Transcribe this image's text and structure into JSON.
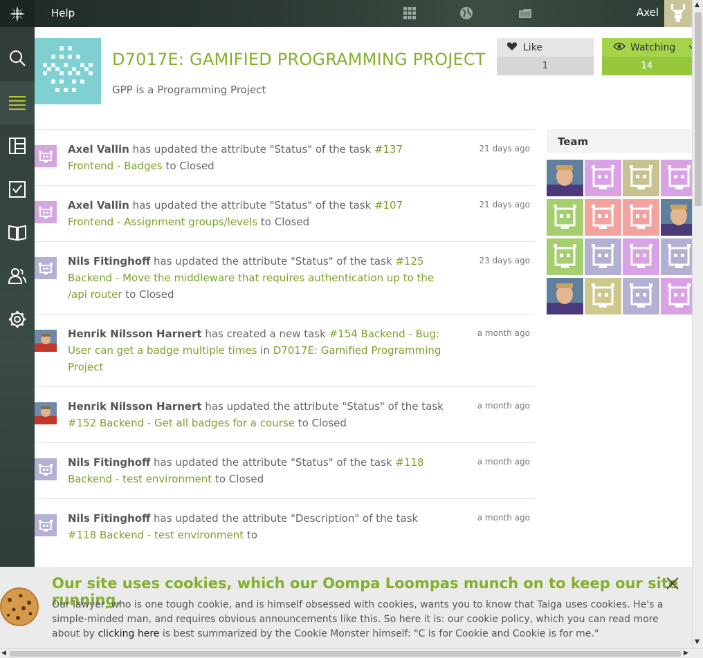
{
  "topbar": {
    "help_label": "Help",
    "username": "Axel",
    "icons": [
      "taiga-logo-icon",
      "projects-grid-icon",
      "discover-globe-icon",
      "folder-icon"
    ]
  },
  "sidebar": {
    "items": [
      {
        "name": "search",
        "icon": "search-icon"
      },
      {
        "name": "timeline",
        "icon": "timeline-lines-icon",
        "active": true
      },
      {
        "name": "kanban",
        "icon": "kanban-icon"
      },
      {
        "name": "backlog",
        "icon": "checklist-icon"
      },
      {
        "name": "wiki",
        "icon": "book-icon"
      },
      {
        "name": "team",
        "icon": "team-icon"
      },
      {
        "name": "settings",
        "icon": "gear-icon"
      }
    ]
  },
  "project": {
    "title": "D7017E: GAMIFIED PROGRAMMING PROJECT",
    "description": "GPP is a Programming Project",
    "like_label": "Like",
    "like_count": "1",
    "watch_label": "Watching",
    "watch_count": "14"
  },
  "timeline": [
    {
      "who": "Axel Vallin",
      "action": " has updated the attribute \"Status\" of the task ",
      "link": "#137 Frontend - Badges",
      "suffix": " to Closed",
      "time": "21 days ago",
      "avatar_color": "#d4a6e0"
    },
    {
      "who": "Axel Vallin",
      "action": " has updated the attribute \"Status\" of the task ",
      "link": "#107 Frontend - Assignment groups/levels",
      "suffix": " to Closed",
      "time": "21 days ago",
      "avatar_color": "#d4a6e0"
    },
    {
      "who": "Nils Fitinghoff",
      "action": " has updated the attribute \"Status\" of the task ",
      "link": "#125 Backend - Move the middleware that requires authentication up to the /api router",
      "suffix": " to Closed",
      "time": "23 days ago",
      "avatar_color": "#b4b0d4"
    },
    {
      "who": "Henrik Nilsson Harnert",
      "action": " has created a new task ",
      "link": "#154 Backend - Bug: User can get a badge multiple times",
      "mid": " in ",
      "link2": "D7017E: Gamified Programming Project",
      "suffix": "",
      "time": "a month ago",
      "avatar_color": "photo"
    },
    {
      "who": "Henrik Nilsson Harnert",
      "action": " has updated the attribute \"Status\" of the task ",
      "link": "#152 Backend - Get all badges for a course",
      "suffix": " to Closed",
      "time": "a month ago",
      "avatar_color": "photo"
    },
    {
      "who": "Nils Fitinghoff",
      "action": " has updated the attribute \"Status\" of the task ",
      "link": "#118 Backend - test environment",
      "suffix": " to Closed",
      "time": "a month ago",
      "avatar_color": "#b4b0d4"
    },
    {
      "who": "Nils Fitinghoff",
      "action": " has updated the attribute \"Description\" of the task ",
      "link": "#118 Backend - test environment",
      "suffix": " to",
      "time": "a month ago",
      "avatar_color": "#b4b0d4"
    }
  ],
  "team": {
    "title": "Team",
    "members": [
      "photo",
      "#d9a2e4",
      "#c8c290",
      "#d9a2e4",
      "#a5cf6f",
      "#f2a3a0",
      "#f2a3a0",
      "photo",
      "#a5cf6f",
      "#b4b0d4",
      "#d9a2e4",
      "#b4b0d4",
      "photo",
      "#cfc88d",
      "#b4b0d4",
      "#d9a2e4"
    ]
  },
  "cookie": {
    "title": "Our site uses cookies, which our Oompa Loompas munch on to keep our site running.",
    "body_before": "Our lawyer, who is one tough cookie, and is himself obsessed with cookies, wants you to know that Taiga uses cookies. He's a simple-minded man, and requires obvious announcements like this. So here it is: our cookie policy, which you can read more about by ",
    "link": "clicking here",
    "body_after": " is best summarized by the Cookie Monster himself: \"C is for Cookie and Cookie is for me.\""
  }
}
